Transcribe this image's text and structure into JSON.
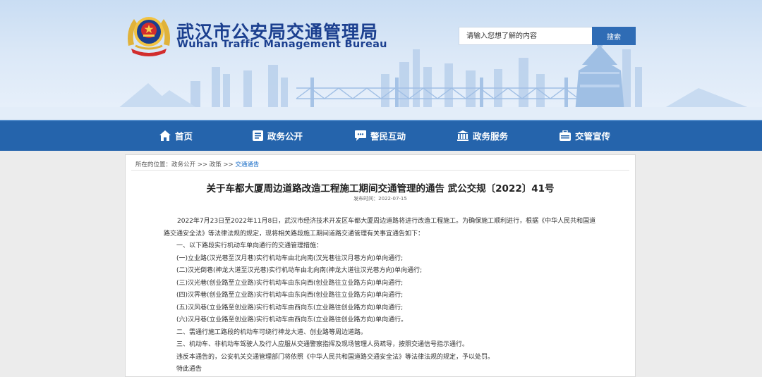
{
  "header": {
    "title": "武汉市公安局交通管理局",
    "subtitle": "Wuhan Traffic Management Bureau",
    "search": {
      "placeholder": "请输入您想了解的内容",
      "button_label": "搜索"
    },
    "colors": {
      "title": "#1b3f8f",
      "search_button": "#2f6cb5"
    }
  },
  "nav": {
    "color": "#2564ac",
    "items": [
      {
        "label": "首页",
        "icon": "home-icon"
      },
      {
        "label": "政务公开",
        "icon": "document-icon"
      },
      {
        "label": "警民互动",
        "icon": "chat-icon"
      },
      {
        "label": "政务服务",
        "icon": "building-icon"
      },
      {
        "label": "交管宣传",
        "icon": "briefcase-icon"
      }
    ]
  },
  "breadcrumb": {
    "prefix": "所在的位置：",
    "items": [
      "政务公开",
      "政策",
      "交通通告"
    ],
    "separator": ">>"
  },
  "article": {
    "title": "关于车都大厦周边道路改造工程施工期间交通管理的通告 武公交规〔2022〕41号",
    "date_label": "发布时间：",
    "date": "2022-07-15",
    "intro": "2022年7月23日至2022年11月8日，武汉市经济技术开发区车都大厦周边道路将进行改造工程施工。为确保施工顺利进行，根据《中华人民共和国道路交通安全法》等法律法规的规定，现将相关路段施工期间道路交通管理有关事宜通告如下：",
    "lines": [
      "一、以下路段实行机动车单向通行的交通管理措施：",
      "(一)立业路(汉光巷至汉月巷)实行机动车由北向南(汉光巷往汉月巷方向)单向通行;",
      "(二)汉光倒巷(神龙大道至汉光巷)实行机动车由北向南(神龙大道往汉光巷方向)单向通行;",
      "(三)汉光巷(创业路至立业路)实行机动车由东向西(创业路往立业路方向)单向通行;",
      "(四)汉霁巷(创业路至立业路)实行机动车由东向西(创业路往立业路方向)单向通行;",
      "(五)汉风巷(立业路至创业路)实行机动车由西向东(立业路往创业路方向)单向通行;",
      "(六)汉月巷(立业路至创业路)实行机动车由西向东(立业路往创业路方向)单向通行。",
      "二、需通行施工路段的机动车可绕行神龙大道、创业路等周边道路。",
      "三、机动车、非机动车驾驶人及行人应服从交通警察指挥及现场管理人员疏导，按照交通信号指示通行。",
      "违反本通告的，公安机关交通管理部门将依照《中华人民共和国道路交通安全法》等法律法规的规定，予以处罚。",
      "特此通告"
    ]
  }
}
